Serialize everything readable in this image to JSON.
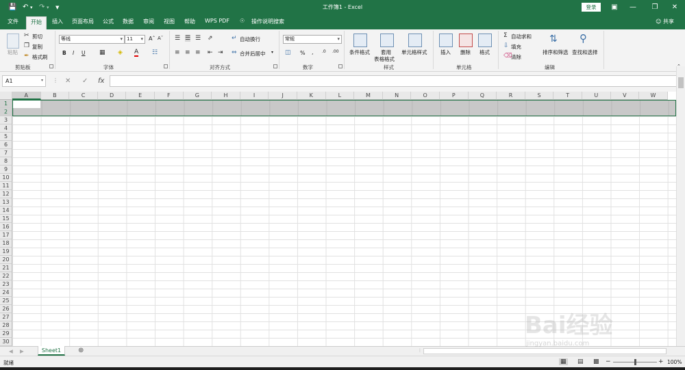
{
  "titlebar": {
    "title": "工作簿1 - Excel",
    "login_label": "登录",
    "save_icon": "save-icon",
    "undo_icon": "undo-icon",
    "redo_icon": "redo-icon"
  },
  "tabs": [
    {
      "label": "文件"
    },
    {
      "label": "开始",
      "active": true
    },
    {
      "label": "插入"
    },
    {
      "label": "页面布局"
    },
    {
      "label": "公式"
    },
    {
      "label": "数据"
    },
    {
      "label": "审阅"
    },
    {
      "label": "视图"
    },
    {
      "label": "帮助"
    },
    {
      "label": "WPS PDF"
    },
    {
      "label": "操作说明搜索"
    }
  ],
  "share_label": "共享",
  "ribbon": {
    "clipboard": {
      "paste": "粘贴",
      "cut": "剪切",
      "copy": "复制",
      "format_painter": "格式刷",
      "group": "剪贴板"
    },
    "font": {
      "name": "等线",
      "size": "11",
      "bold": "B",
      "italic": "I",
      "underline": "U",
      "group": "字体"
    },
    "alignment": {
      "wrap": "自动换行",
      "merge": "合并后居中",
      "group": "对齐方式"
    },
    "number": {
      "format": "常规",
      "percent": "%",
      "comma": ",",
      "group": "数字"
    },
    "styles": {
      "conditional": "条件格式",
      "table1": "套用",
      "table2": "表格格式",
      "cell_styles": "单元格样式",
      "group": "样式"
    },
    "cells": {
      "insert": "插入",
      "delete": "删除",
      "format": "格式",
      "group": "单元格"
    },
    "editing": {
      "autosum": "自动求和",
      "fill": "填充",
      "clear": "清除",
      "sort": "排序和筛选",
      "find": "查找和选择",
      "group": "编辑"
    }
  },
  "formula_bar": {
    "name_box": "A1",
    "fx": "fx",
    "value": ""
  },
  "columns": [
    "A",
    "B",
    "C",
    "D",
    "E",
    "F",
    "G",
    "H",
    "I",
    "J",
    "K",
    "L",
    "M",
    "N",
    "O",
    "P",
    "Q",
    "R",
    "S",
    "T",
    "U",
    "V",
    "W"
  ],
  "rows": [
    "1",
    "2",
    "3",
    "4",
    "5",
    "6",
    "7",
    "8",
    "9",
    "10",
    "11",
    "12",
    "13",
    "14",
    "15",
    "16",
    "17",
    "18",
    "19",
    "20",
    "21",
    "22",
    "23",
    "24",
    "25",
    "26",
    "27",
    "28",
    "29",
    "30"
  ],
  "sheet_tab": "Sheet1",
  "status": {
    "ready": "就绪",
    "zoom": "100%"
  },
  "watermark": {
    "text": "Bai经验",
    "url": "jingyan.baidu.com"
  }
}
